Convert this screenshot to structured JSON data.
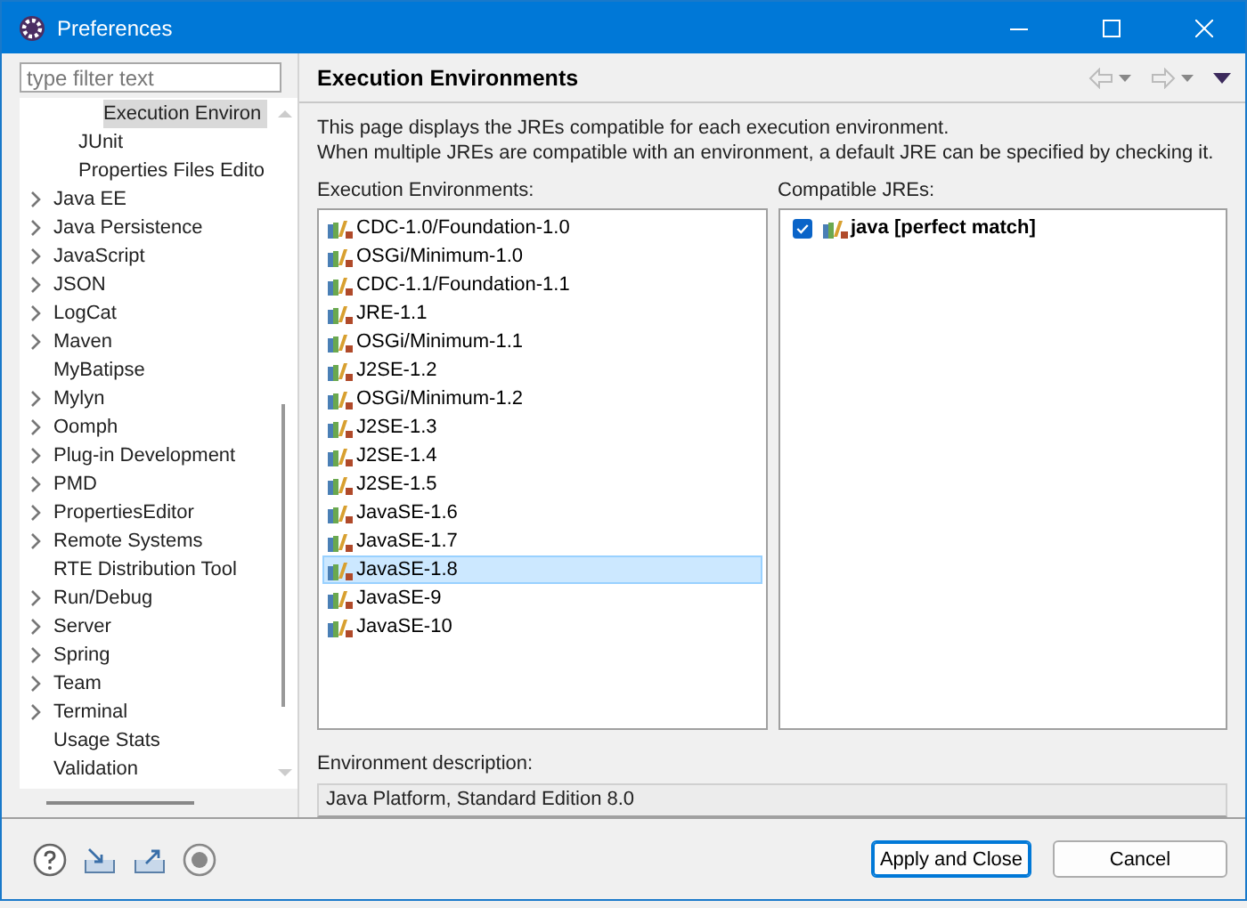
{
  "window": {
    "title": "Preferences"
  },
  "filter": {
    "placeholder": "type filter text"
  },
  "tree": [
    {
      "children": [
        {
          "children": [
            {
              "label": "Execution Environ",
              "expandable": false,
              "selected": true
            }
          ]
        },
        {
          "label": "JUnit",
          "expandable": false,
          "selected": false
        },
        {
          "label": "Properties Files Edito",
          "expandable": false,
          "selected": false
        }
      ]
    },
    {
      "label": "Java EE",
      "expandable": true,
      "selected": false
    },
    {
      "label": "Java Persistence",
      "expandable": true,
      "selected": false
    },
    {
      "label": "JavaScript",
      "expandable": true,
      "selected": false
    },
    {
      "label": "JSON",
      "expandable": true,
      "selected": false
    },
    {
      "label": "LogCat",
      "expandable": true,
      "selected": false
    },
    {
      "label": "Maven",
      "expandable": true,
      "selected": false
    },
    {
      "label": "MyBatipse",
      "expandable": false,
      "selected": false
    },
    {
      "label": "Mylyn",
      "expandable": true,
      "selected": false
    },
    {
      "label": "Oomph",
      "expandable": true,
      "selected": false
    },
    {
      "label": "Plug-in Development",
      "expandable": true,
      "selected": false
    },
    {
      "label": "PMD",
      "expandable": true,
      "selected": false
    },
    {
      "label": "PropertiesEditor",
      "expandable": true,
      "selected": false
    },
    {
      "label": "Remote Systems",
      "expandable": true,
      "selected": false
    },
    {
      "label": "RTE Distribution Tool",
      "expandable": false,
      "selected": false
    },
    {
      "label": "Run/Debug",
      "expandable": true,
      "selected": false
    },
    {
      "label": "Server",
      "expandable": true,
      "selected": false
    },
    {
      "label": "Spring",
      "expandable": true,
      "selected": false
    },
    {
      "label": "Team",
      "expandable": true,
      "selected": false
    },
    {
      "label": "Terminal",
      "expandable": true,
      "selected": false
    },
    {
      "label": "Usage Stats",
      "expandable": false,
      "selected": false
    },
    {
      "label": "Validation",
      "expandable": false,
      "selected": false
    }
  ],
  "page": {
    "title": "Execution Environments",
    "description": [
      "This page displays the JREs compatible for each execution environment.",
      "When multiple JREs are compatible with an environment, a default JRE can be specified by checking it."
    ]
  },
  "environments": {
    "label": "Execution Environments:",
    "items": [
      {
        "label": "CDC-1.0/Foundation-1.0",
        "selected": false
      },
      {
        "label": "OSGi/Minimum-1.0",
        "selected": false
      },
      {
        "label": "CDC-1.1/Foundation-1.1",
        "selected": false
      },
      {
        "label": "JRE-1.1",
        "selected": false
      },
      {
        "label": "OSGi/Minimum-1.1",
        "selected": false
      },
      {
        "label": "J2SE-1.2",
        "selected": false
      },
      {
        "label": "OSGi/Minimum-1.2",
        "selected": false
      },
      {
        "label": "J2SE-1.3",
        "selected": false
      },
      {
        "label": "J2SE-1.4",
        "selected": false
      },
      {
        "label": "J2SE-1.5",
        "selected": false
      },
      {
        "label": "JavaSE-1.6",
        "selected": false
      },
      {
        "label": "JavaSE-1.7",
        "selected": false
      },
      {
        "label": "JavaSE-1.8",
        "selected": true
      },
      {
        "label": "JavaSE-9",
        "selected": false
      },
      {
        "label": "JavaSE-10",
        "selected": false
      }
    ]
  },
  "compatible_jres": {
    "label": "Compatible JREs:",
    "items": [
      {
        "label": "java [perfect match]",
        "checked": true
      }
    ]
  },
  "environment_description": {
    "label": "Environment description:",
    "value": "Java Platform, Standard Edition 8.0"
  },
  "buttons": [
    {
      "label": "Apply and Close",
      "default": true
    },
    {
      "label": "Cancel",
      "default": false
    }
  ]
}
